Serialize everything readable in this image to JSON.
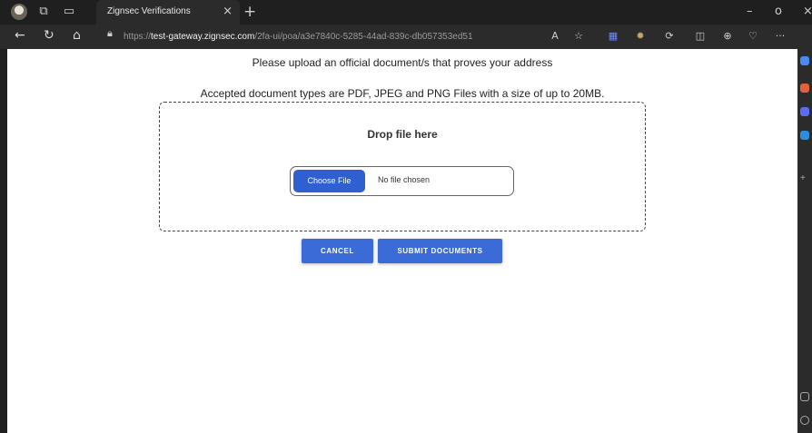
{
  "browser": {
    "tab_title": "Zignsec Verifications",
    "tab_close": "×",
    "new_tab": "+",
    "url": {
      "proto": "https://",
      "host": "test-gateway.zignsec.com",
      "path": "/2fa-ui/poa/a3e7840c-5285-44ad-839c-db057353ed51"
    },
    "window_controls": {
      "minimize": "–",
      "maximize": "ᴏ",
      "close": "×"
    },
    "more": "···"
  },
  "page": {
    "instruction": "Please upload an official document/s that proves your address",
    "accepted_types": "Accepted document types are PDF, JPEG and PNG Files with a size of up to 20MB.",
    "dropzone": {
      "label": "Drop file here",
      "choose_file": "Choose File",
      "file_status": "No file chosen"
    },
    "buttons": {
      "cancel": "CANCEL",
      "submit": "SUBMIT DOCUMENTS"
    }
  },
  "colors": {
    "primary": "#3a6bd6",
    "choose_button": "#2f5fd0",
    "chrome": "#2b2b2b"
  }
}
